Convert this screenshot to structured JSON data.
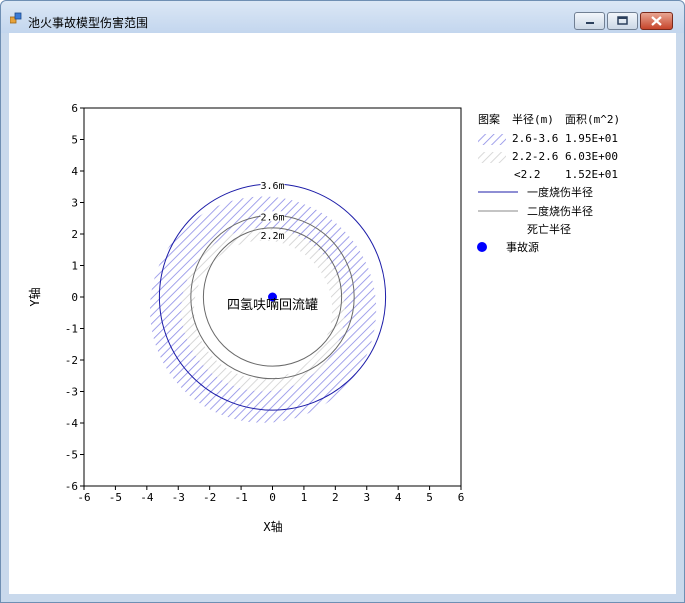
{
  "window": {
    "title": "池火事故模型伤害范围"
  },
  "chart_data": {
    "type": "scatter",
    "xlabel": "X轴",
    "ylabel": "Y轴",
    "xlim": [
      -6,
      6
    ],
    "ylim": [
      -6,
      6
    ],
    "xticks": [
      "-6",
      "-5",
      "-4",
      "-3",
      "-2",
      "-1",
      "0",
      "1",
      "2",
      "3",
      "4",
      "5",
      "6"
    ],
    "yticks": [
      "-6",
      "-5",
      "-4",
      "-3",
      "-2",
      "-1",
      "0",
      "1",
      "2",
      "3",
      "4",
      "5",
      "6"
    ],
    "grid": false,
    "circles": [
      {
        "label": "3.6m",
        "radius": 3.6,
        "color": "#1c1ca8"
      },
      {
        "label": "2.6m",
        "radius": 2.6,
        "color": "#6a6a6a"
      },
      {
        "label": "2.2m",
        "radius": 2.2,
        "color": "#6a6a6a"
      }
    ],
    "hatched_areas": [
      {
        "inner": 2.6,
        "outer": 3.6,
        "color": "#8a8ae6"
      },
      {
        "inner": 2.2,
        "outer": 2.6,
        "color": "#c8c8c8"
      }
    ],
    "hatch_center_offset": [
      -0.3,
      -0.4
    ],
    "source": {
      "x": 0,
      "y": 0,
      "label": "四氢呋喃回流罐",
      "color": "#0000ff"
    },
    "legend": {
      "position": "right",
      "header": [
        "图案",
        "半径(m)",
        "面积(m^2)"
      ],
      "area_rows": [
        {
          "range": "2.6-3.6",
          "area": "1.95E+01"
        },
        {
          "range": "2.2-2.6",
          "area": "6.03E+00"
        },
        {
          "range": "<2.2",
          "area": "1.52E+01"
        }
      ],
      "line_rows": [
        {
          "label": "一度烧伤半径",
          "color": "#1c1ca8"
        },
        {
          "label": "二度烧伤半径",
          "color": "#8a8a8a"
        },
        {
          "label": "死亡半径",
          "color": "#ffffff"
        }
      ],
      "marker_label": "事故源"
    }
  }
}
